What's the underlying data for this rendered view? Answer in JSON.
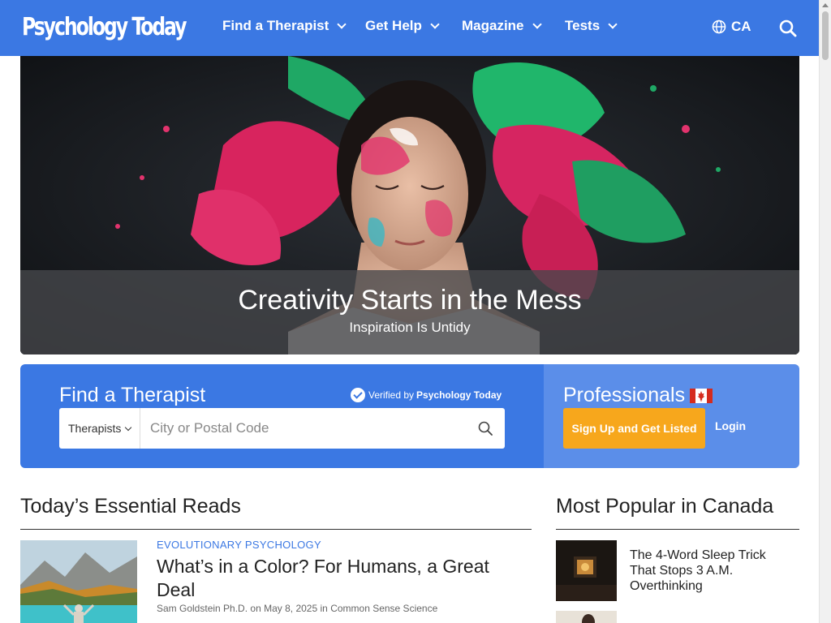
{
  "header": {
    "logo": "Psychology Today",
    "nav": [
      {
        "label": "Find a Therapist"
      },
      {
        "label": "Get Help"
      },
      {
        "label": "Magazine"
      },
      {
        "label": "Tests"
      }
    ],
    "region": "CA"
  },
  "hero": {
    "title": "Creativity Starts in the Mess",
    "subtitle": "Inspiration Is Untidy"
  },
  "finder": {
    "title": "Find a Therapist",
    "verified_prefix": "Verified by",
    "verified_brand": "Psychology Today",
    "type_select": "Therapists",
    "city_placeholder": "City or Postal Code"
  },
  "professionals": {
    "title": "Professionals",
    "signup": "Sign Up and Get Listed",
    "login": "Login"
  },
  "essential": {
    "heading": "Today’s Essential Reads",
    "articles": [
      {
        "category": "EVOLUTIONARY PSYCHOLOGY",
        "title": "What’s in a Color? For Humans, a Great Deal",
        "author": "Sam Goldstein Ph.D.",
        "on": "on",
        "date": "May 8, 2025",
        "in": "in",
        "blog": "Common Sense Science"
      }
    ]
  },
  "popular": {
    "heading": "Most Popular in Canada",
    "items": [
      {
        "title": "The 4-Word Sleep Trick That Stops 3 A.M. Overthinking"
      }
    ]
  },
  "colors": {
    "brand_blue": "#3b78e3",
    "pros_blue": "#5b8ee9",
    "signup_orange": "#f7a71c"
  }
}
